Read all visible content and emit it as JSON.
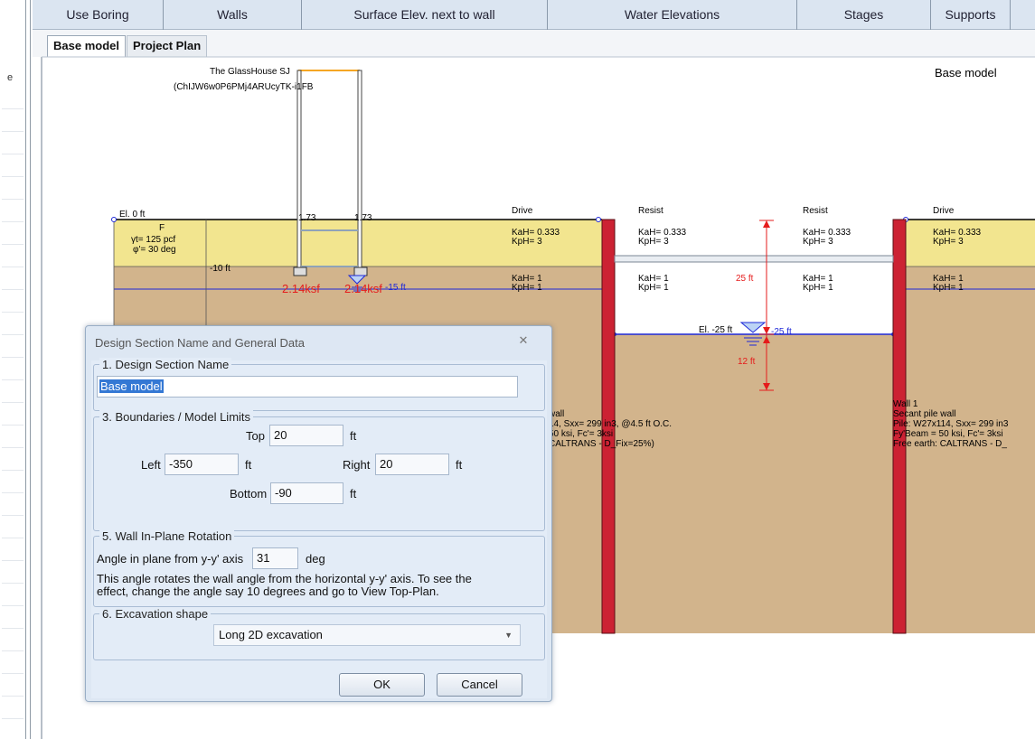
{
  "columns": [
    {
      "label": "Use Boring"
    },
    {
      "label": "Walls"
    },
    {
      "label": "Surface Elev. next to wall"
    },
    {
      "label": "Water Elevations"
    },
    {
      "label": "Stages"
    },
    {
      "label": "Supports"
    }
  ],
  "tabs": [
    {
      "label": "Base model",
      "active": true
    },
    {
      "label": "Project Plan",
      "active": false
    }
  ],
  "left_strip": {
    "cut_text": "e"
  },
  "drawing": {
    "model_label": "Base model",
    "site_title": "The GlassHouse SJ",
    "site_id": "(ChIJW6w0P6PMj4ARUcyTK-i1FB",
    "elevation_top": "El. 0 ft",
    "soil_layer": {
      "name": "F",
      "unit_weight": "γt= 125 pcf",
      "friction_angle": "φ'= 30 deg",
      "depth_label": "-10 ft"
    },
    "footing_labels": [
      "1.73 ",
      "1.73 "
    ],
    "stress_labels": [
      "2.14ksf",
      "2.14ksf"
    ],
    "water_left": "-15 ft",
    "panels": [
      {
        "heading": "Drive",
        "upper_kah": "KaH= 0.333",
        "upper_kph": "KpH= 3",
        "lower_kah": "KaH= 1",
        "lower_kph": "KpH= 1"
      },
      {
        "heading": "Resist",
        "upper_kah": "KaH= 0.333",
        "upper_kph": "KpH= 3",
        "lower_kah": "KaH= 1",
        "lower_kph": "KpH= 1"
      },
      {
        "heading": "Resist",
        "upper_kah": "KaH= 0.333",
        "upper_kph": "KpH= 3",
        "lower_kah": "KaH= 1",
        "lower_kph": "KpH= 1"
      },
      {
        "heading": "Drive",
        "upper_kah": "KaH= 0.333",
        "upper_kph": "KpH= 3",
        "lower_kah": "KaH= 1",
        "lower_kph": "KpH= 1"
      }
    ],
    "excavation_depth": "25 ft",
    "embedment_depth": "12 ft",
    "excavation_elevation": "El. -25 ft",
    "water_excavation": "-25 ft",
    "left_wall_notes": [
      "wall",
      "14, Sxx= 299 in3, @4.5 ft O.C.",
      "50 ksi, Fc'= 3ksi",
      "CALTRANS - D_Fix=25%)"
    ],
    "right_wall_notes": [
      "Wall 1",
      "Secant pile wall",
      "Pile: W27x114, Sxx= 299 in3",
      "Fy'Beam = 50 ksi, Fc'= 3ksi",
      "Free earth: CALTRANS - D_"
    ],
    "colors": {
      "soil_upper": "#f2e58f",
      "soil_lower": "#d2b48c",
      "wall": "#cc2233",
      "water_line": "#1e28d8",
      "dimension": "#e51b1b"
    }
  },
  "dialog": {
    "title": "Design Section Name and General Data",
    "close_icon": "✕",
    "section1": {
      "legend": "1. Design Section Name",
      "name_value": "Base model"
    },
    "section3": {
      "legend": "3. Boundaries / Model Limits",
      "top_label": "Top",
      "top_value": "20",
      "top_unit": "ft",
      "left_label": "Left",
      "left_value": "-350",
      "left_unit": "ft",
      "right_label": "Right",
      "right_value": "20",
      "right_unit": "ft",
      "bottom_label": "Bottom",
      "bottom_value": "-90",
      "bottom_unit": "ft"
    },
    "section5": {
      "legend": "5. Wall In-Plane Rotation",
      "angle_label": "Angle in plane from y-y' axis",
      "angle_value": "31",
      "angle_unit": "deg",
      "help_line1": "This angle rotates the wall angle from the horizontal y-y' axis. To see the",
      "help_line2": "effect, change the angle say 10 degrees and go to View Top-Plan."
    },
    "section6": {
      "legend": "6. Excavation shape",
      "selected": "Long 2D excavation"
    },
    "ok_label": "OK",
    "cancel_label": "Cancel"
  }
}
